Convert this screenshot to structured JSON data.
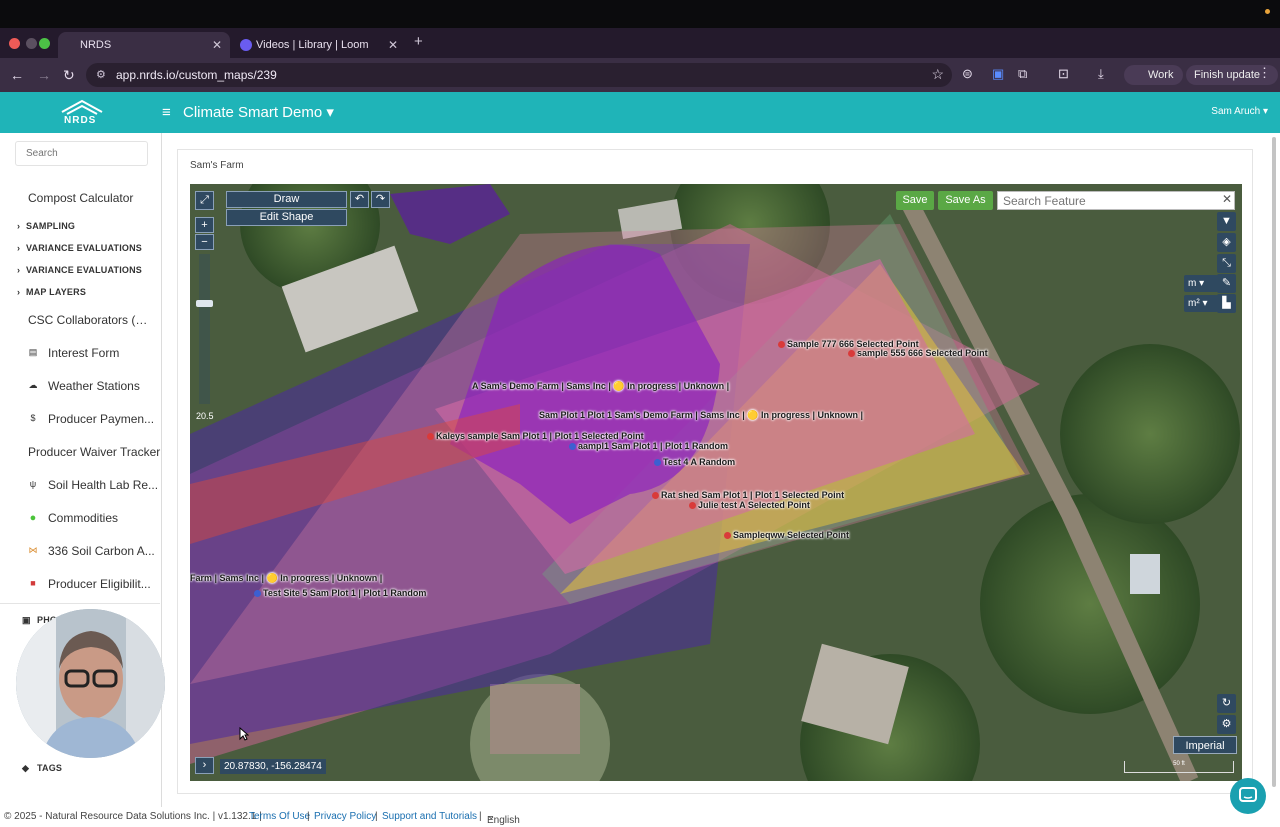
{
  "browser": {
    "tabs": [
      {
        "title": "NRDS",
        "active": true
      },
      {
        "title": "Videos | Library | Loom",
        "active": false
      }
    ],
    "new_tab_icon": "plus-icon",
    "url": "app.nrds.io/custom_maps/239",
    "profile_label": "Work",
    "update_label": "Finish update"
  },
  "header": {
    "logo_text": "NRDS",
    "app_title": "Climate Smart Demo ▾",
    "user_name": "Sam Aruch ▾",
    "accent_color": "#1fb4b8"
  },
  "sidebar": {
    "search_placeholder": "Search",
    "items": [
      {
        "label": "Compost Calculator",
        "kind": "link",
        "icon": ""
      },
      {
        "label": "SAMPLING",
        "kind": "section",
        "icon": "chevron-right-icon"
      },
      {
        "label": "VARIANCE EVALUATIONS",
        "kind": "section",
        "icon": "chevron-right-icon"
      },
      {
        "label": "VARIANCE EVALUATIONS",
        "kind": "section",
        "icon": "chevron-right-icon"
      },
      {
        "label": "MAP LAYERS",
        "kind": "section",
        "icon": "chevron-right-icon"
      },
      {
        "label": "CSC Collaborators (Pe...",
        "kind": "link",
        "icon": ""
      },
      {
        "label": "Interest Form",
        "kind": "link",
        "icon": "form-icon"
      },
      {
        "label": "Weather Stations",
        "kind": "link",
        "icon": "weather-icon"
      },
      {
        "label": "Producer Paymen...",
        "kind": "link",
        "icon": "dollar-icon"
      },
      {
        "label": "Producer Waiver Tracker",
        "kind": "link",
        "icon": ""
      },
      {
        "label": "Soil Health Lab Re...",
        "kind": "link",
        "icon": "lab-icon"
      },
      {
        "label": "Commodities",
        "kind": "link",
        "icon": "green-dot-icon"
      },
      {
        "label": "336 Soil Carbon A...",
        "kind": "link",
        "icon": "carbon-icon"
      },
      {
        "label": "Producer Eligibilit...",
        "kind": "link",
        "icon": "truck-icon"
      }
    ],
    "partial_sections": [
      "PHO",
      "TAGS"
    ]
  },
  "main": {
    "card_title": "Sam's Farm",
    "map": {
      "toolbar": {
        "draw_label": "Draw",
        "edit_shape_label": "Edit Shape",
        "save_label": "Save",
        "save_as_label": "Save As"
      },
      "search_placeholder": "Search Feature",
      "zoom_level": "20.5",
      "unit_length": "m",
      "unit_area": "m²",
      "coordinates": "20.87830, -156.28474",
      "unit_system": "Imperial",
      "scale_label": "50 ft",
      "labels": [
        {
          "text": "Sample 777 666 Selected Point",
          "dot": "red"
        },
        {
          "text": "sample 555 666 Selected Point",
          "dot": "red"
        },
        {
          "text": "A Sam's Demo Farm | Sams Inc | 🟡 In progress | Unknown |",
          "dot": "none"
        },
        {
          "text": "Sam Plot 1 Plot 1 Sam's Demo Farm | Sams Inc | 🟡 In progress | Unknown |",
          "dot": "none"
        },
        {
          "text": "Kaleys sample Sam Plot 1 | Plot 1 Selected Point",
          "dot": "red"
        },
        {
          "text": "aampl1 Sam Plot 1 | Plot 1 Random",
          "dot": "blue"
        },
        {
          "text": "Test 4 A Random",
          "dot": "blue"
        },
        {
          "text": "Rat shed  Sam Plot 1 | Plot 1 Selected Point",
          "dot": "red"
        },
        {
          "text": "Julie test A Selected Point",
          "dot": "red"
        },
        {
          "text": "Sampleqww Selected Point",
          "dot": "red"
        },
        {
          "text": "Farm | Sams Inc | 🟡 In progress | Unknown |",
          "dot": "none"
        },
        {
          "text": "Test Site 5 Sam Plot 1 | Plot 1 Random",
          "dot": "blue"
        }
      ]
    }
  },
  "footer": {
    "copyright": "© 2025 - Natural Resource Data Solutions Inc. | v1.132.1 |",
    "terms": "Terms Of Use",
    "privacy": "Privacy Policy",
    "support": "Support and Tutorials",
    "language": "English"
  }
}
